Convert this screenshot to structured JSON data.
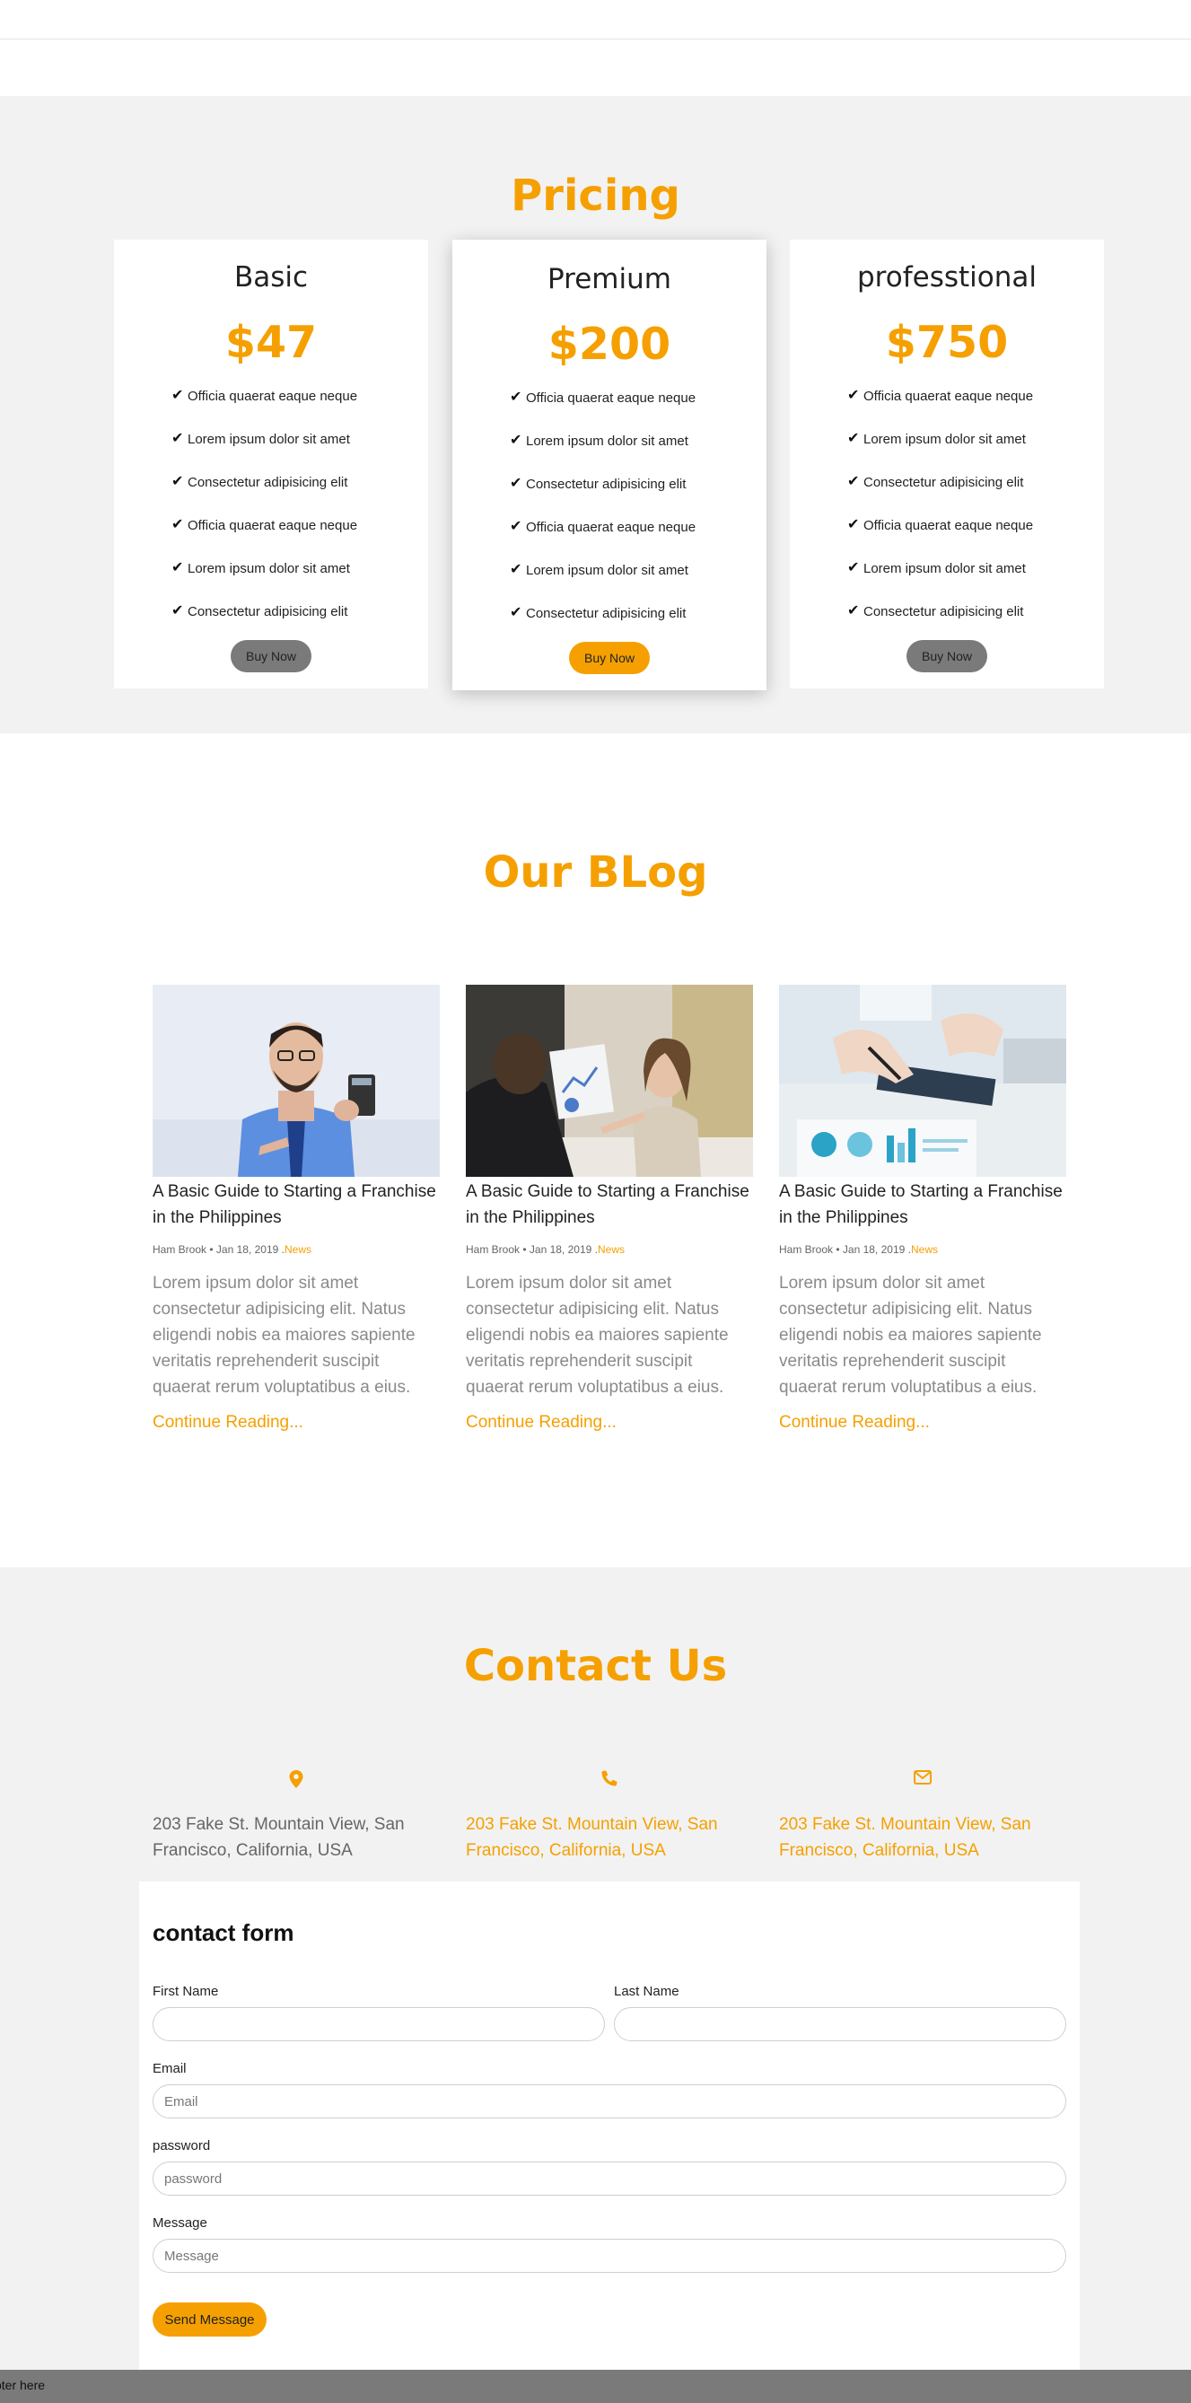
{
  "theme": {
    "accent": "#f5a000",
    "section_bg": "#f2f2f2",
    "muted_button": "#7a7a7a"
  },
  "pricing": {
    "title": "Pricing",
    "plans": [
      {
        "name": "Basic",
        "price": "$47",
        "features": [
          "Officia quaerat eaque neque",
          "Lorem ipsum dolor sit amet",
          "Consectetur adipisicing elit",
          "Officia quaerat eaque neque",
          "Lorem ipsum dolor sit amet",
          "Consectetur adipisicing elit"
        ],
        "button": "Buy Now"
      },
      {
        "name": "Premium",
        "price": "$200",
        "features": [
          "Officia quaerat eaque neque",
          "Lorem ipsum dolor sit amet",
          "Consectetur adipisicing elit",
          "Officia quaerat eaque neque",
          "Lorem ipsum dolor sit amet",
          "Consectetur adipisicing elit"
        ],
        "button": "Buy Now"
      },
      {
        "name": "professtional",
        "price": "$750",
        "features": [
          "Officia quaerat eaque neque",
          "Lorem ipsum dolor sit amet",
          "Consectetur adipisicing elit",
          "Officia quaerat eaque neque",
          "Lorem ipsum dolor sit amet",
          "Consectetur adipisicing elit"
        ],
        "button": "Buy Now"
      }
    ]
  },
  "blog": {
    "title": "Our BLog",
    "posts": [
      {
        "image": "man-with-calculator-photo",
        "title": "A Basic Guide to Starting a Franchise in the Philippines",
        "author": "Ham Brook",
        "date": "Jan 18, 2019",
        "category": "News",
        "excerpt": "Lorem ipsum dolor sit amet consectetur adipisicing elit. Natus eligendi nobis ea maiores sapiente veritatis reprehenderit suscipit quaerat rerum voluptatibus a eius.",
        "read_more": "Continue Reading..."
      },
      {
        "image": "business-meeting-photo",
        "title": "A Basic Guide to Starting a Franchise in the Philippines",
        "author": "Ham Brook",
        "date": "Jan 18, 2019",
        "category": "News",
        "excerpt": "Lorem ipsum dolor sit amet consectetur adipisicing elit. Natus eligendi nobis ea maiores sapiente veritatis reprehenderit suscipit quaerat rerum voluptatibus a eius.",
        "read_more": "Continue Reading..."
      },
      {
        "image": "financial-charts-photo",
        "title": "A Basic Guide to Starting a Franchise in the Philippines",
        "author": "Ham Brook",
        "date": "Jan 18, 2019",
        "category": "News",
        "excerpt": "Lorem ipsum dolor sit amet consectetur adipisicing elit. Natus eligendi nobis ea maiores sapiente veritatis reprehenderit suscipit quaerat rerum voluptatibus a eius.",
        "read_more": "Continue Reading..."
      }
    ]
  },
  "contact": {
    "title": "Contact Us",
    "info": [
      {
        "icon": "map-marker-icon",
        "text": "203 Fake St. Mountain View, San Francisco, California, USA"
      },
      {
        "icon": "phone-icon",
        "text": "203 Fake St. Mountain View, San Francisco, California, USA"
      },
      {
        "icon": "envelope-icon",
        "text": "203 Fake St. Mountain View, San Francisco, California, USA"
      }
    ],
    "form": {
      "heading": "contact form",
      "first_name_label": "First Name",
      "first_name_value": "",
      "last_name_label": "Last Name",
      "last_name_value": "",
      "email_label": "Email",
      "email_placeholder": "Email",
      "password_label": "password",
      "password_placeholder": "password",
      "message_label": "Message",
      "message_placeholder": "Message",
      "submit": "Send Message"
    }
  },
  "footer": {
    "text": "oter here"
  }
}
